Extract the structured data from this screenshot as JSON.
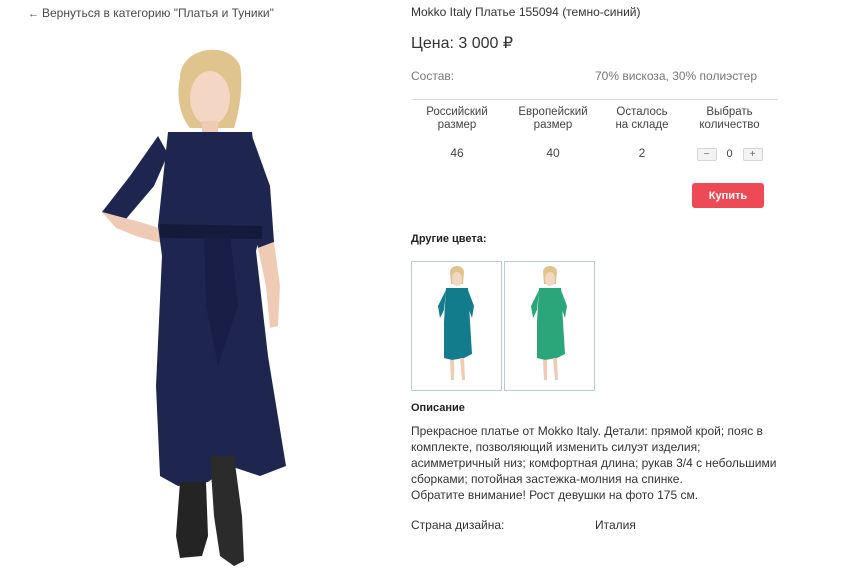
{
  "nav": {
    "arrow": "←",
    "back_label": "Вернуться в категорию \"Платья и Туники\""
  },
  "product": {
    "title": "Mokko Italy Платье 155094 (темно-синий)",
    "price": "Цена: 3 000 ₽",
    "composition_label": "Состав:",
    "composition_value": "70% вискоза, 30% полиэстер",
    "main_dress_color": "#1e2650"
  },
  "sizes": {
    "headers": [
      "Российский\nразмер",
      "Европейский\nразмер",
      "Осталось\nна складе",
      "Выбрать\nколичество"
    ],
    "values": [
      "46",
      "40",
      "2"
    ],
    "quantity": "0",
    "minus": "−",
    "plus": "+"
  },
  "buy": {
    "label": "Купить",
    "color": "#ee4a55"
  },
  "colors": {
    "heading": "Другие цвета:",
    "variants": [
      {
        "name": "teal-variant",
        "color": "#137c8c"
      },
      {
        "name": "green-variant",
        "color": "#2aa67a"
      }
    ]
  },
  "description": {
    "heading": "Описание",
    "text": "Прекрасное платье от Mokko Italy. Детали: прямой крой; пояс в комплекте, позволяющий изменить силуэт изделия; асимметричный низ; комфортная длина; рукав 3/4 с небольшими сборками; потойная застежка-молния на спинке.",
    "note": "Обратите внимание! Рост девушки на фото 175 см."
  },
  "country": {
    "label": "Страна дизайна:",
    "value": "Италия"
  }
}
